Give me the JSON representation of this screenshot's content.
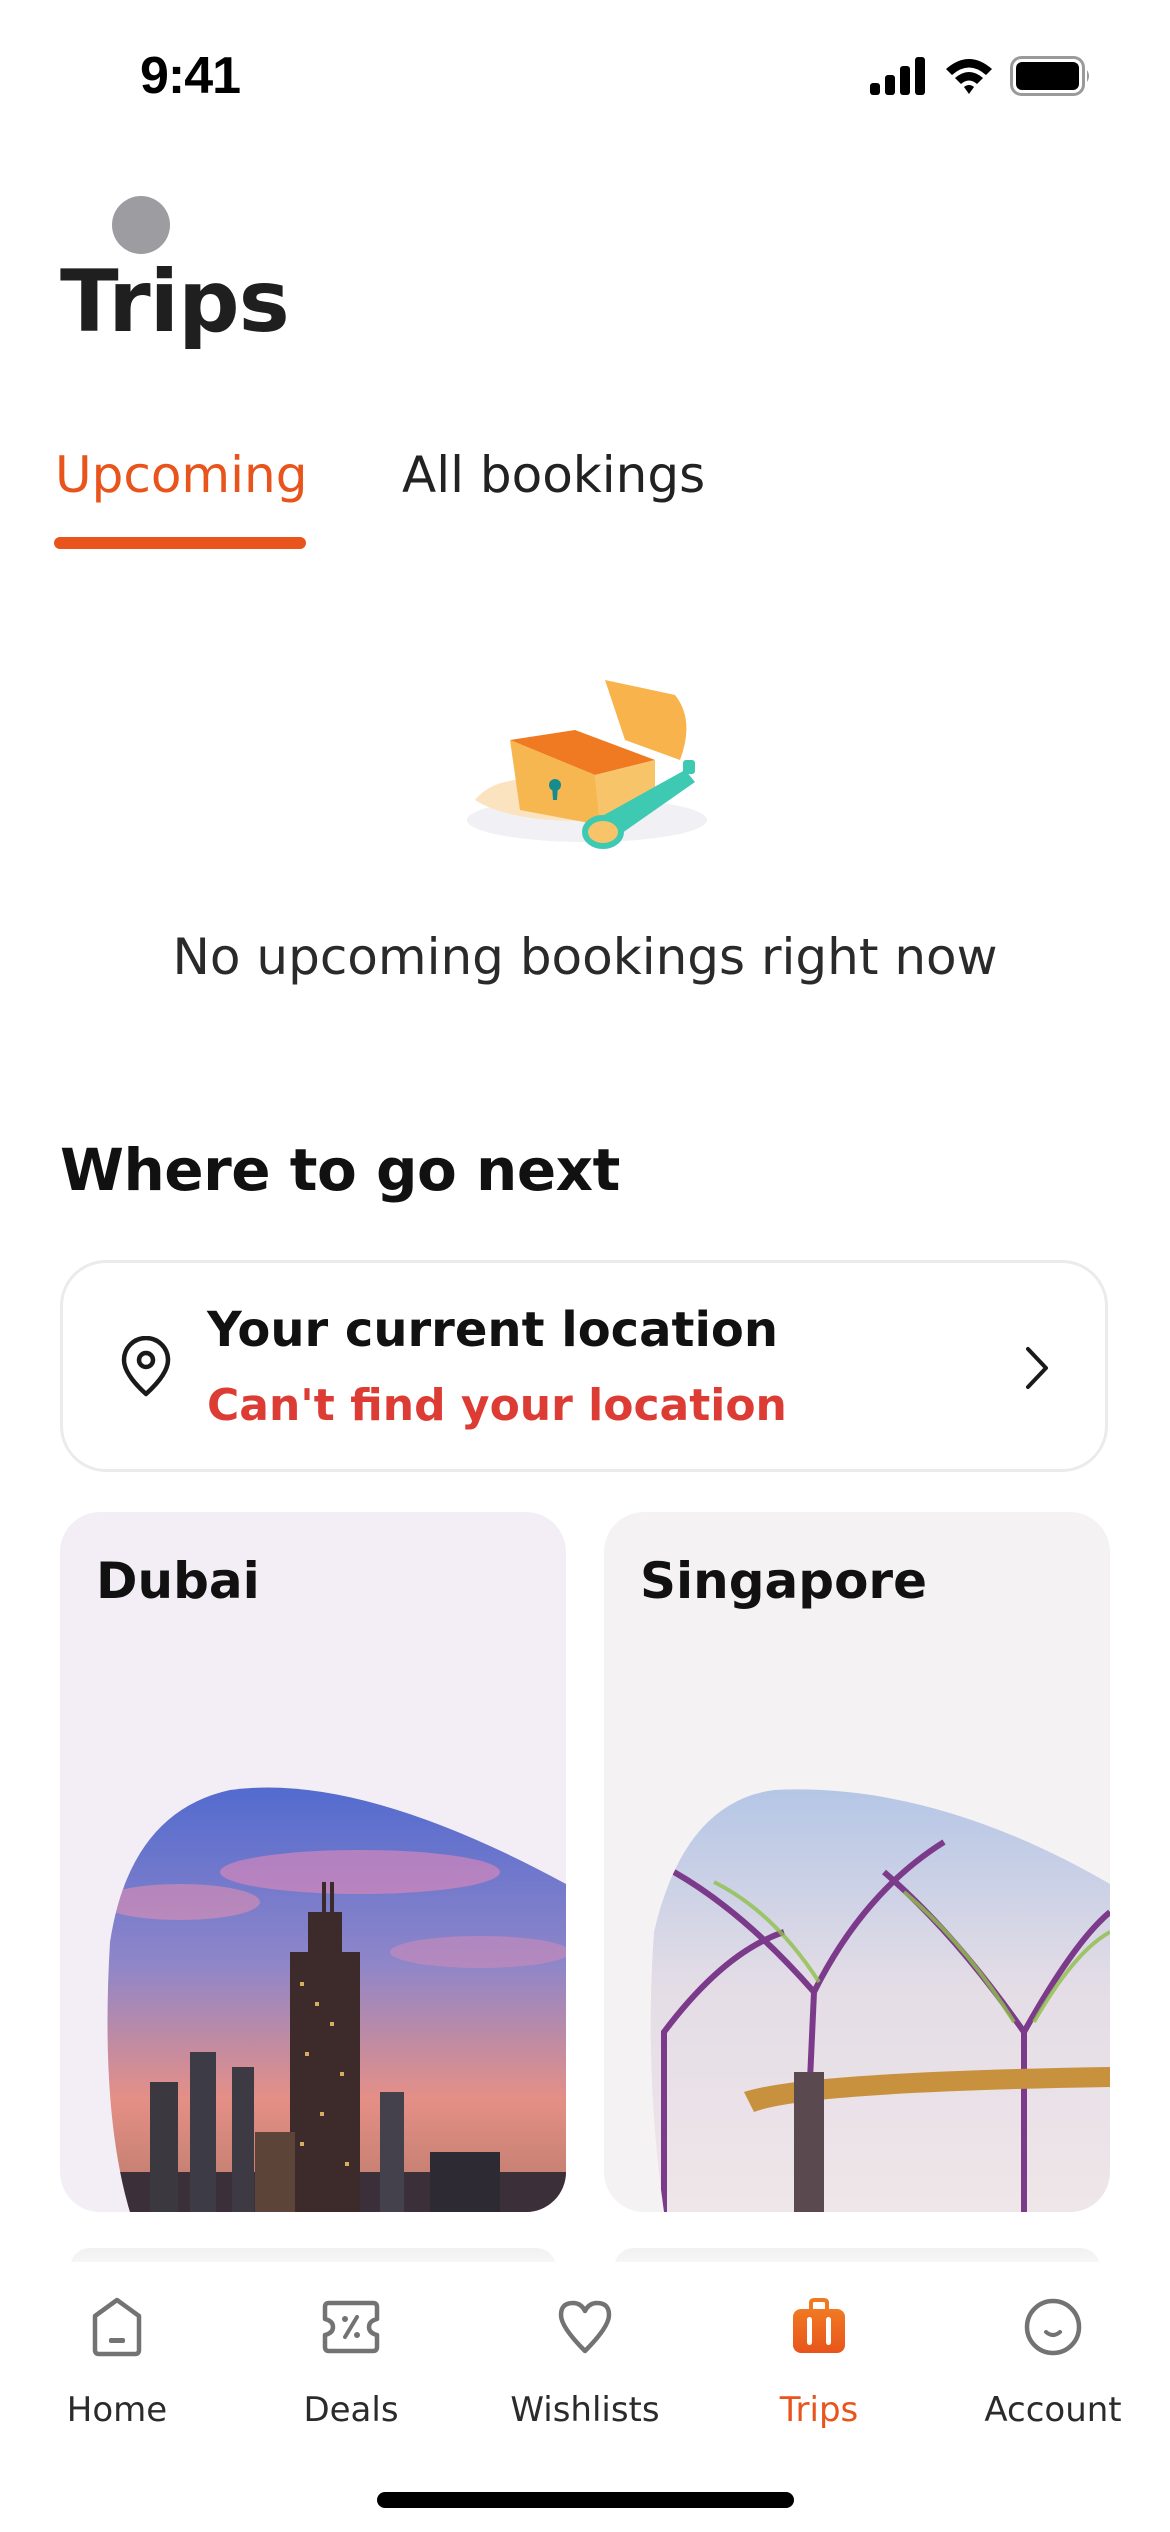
{
  "status_bar": {
    "time": "9:41"
  },
  "header": {
    "title": "Trips"
  },
  "tabs": [
    {
      "label": "Upcoming",
      "active": true
    },
    {
      "label": "All bookings",
      "active": false
    }
  ],
  "empty_state": {
    "illustration": "treasure-chest-illustration",
    "message": "No upcoming bookings right now"
  },
  "where_next": {
    "title": "Where to go next",
    "location_card": {
      "title": "Your current location",
      "subtitle": "Can't find your location",
      "icon": "location-pin-icon"
    },
    "destinations": [
      {
        "name": "Dubai",
        "image": "dubai-skyline-image"
      },
      {
        "name": "Singapore",
        "image": "singapore-supertrees-image"
      }
    ]
  },
  "bottom_nav": [
    {
      "label": "Home",
      "icon": "home-icon",
      "active": false
    },
    {
      "label": "Deals",
      "icon": "deals-ticket-icon",
      "active": false
    },
    {
      "label": "Wishlists",
      "icon": "heart-icon",
      "active": false
    },
    {
      "label": "Trips",
      "icon": "suitcase-icon",
      "active": true
    },
    {
      "label": "Account",
      "icon": "account-face-icon",
      "active": false
    }
  ],
  "colors": {
    "accent": "#e8541b",
    "error": "#dc3c34"
  }
}
